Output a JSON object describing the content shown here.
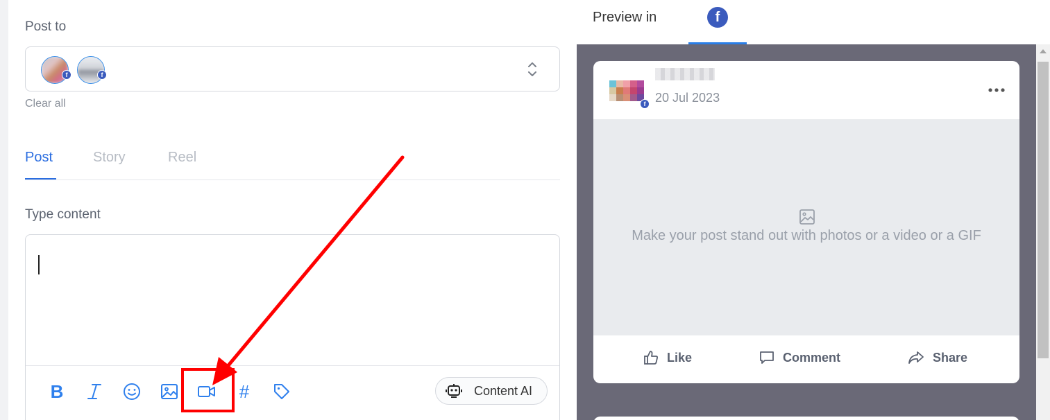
{
  "composer": {
    "post_to_label": "Post to",
    "clear_all": "Clear all",
    "tabs": [
      {
        "label": "Post",
        "active": true
      },
      {
        "label": "Story",
        "active": false
      },
      {
        "label": "Reel",
        "active": false
      }
    ],
    "type_content_label": "Type content",
    "toolbar": {
      "icons": [
        "bold-icon",
        "italic-icon",
        "emoji-icon",
        "image-icon",
        "video-icon",
        "hashtag-icon",
        "tag-icon"
      ],
      "bold_glyph": "B",
      "hashtag_glyph": "#",
      "content_ai_label": "Content AI"
    },
    "accounts": [
      {
        "network": "facebook",
        "badge": "f"
      },
      {
        "network": "facebook",
        "badge": "f"
      }
    ]
  },
  "preview": {
    "header_label": "Preview in",
    "network_tab_glyph": "f",
    "card": {
      "date": "20 Jul 2023",
      "badge": "f",
      "media_placeholder": "Make your post stand out with photos or a video or a GIF",
      "actions": {
        "like": "Like",
        "comment": "Comment",
        "share": "Share"
      }
    }
  },
  "colors": {
    "accent": "#2a6de0",
    "facebook": "#3b5bbd",
    "preview_bg": "#6a6977",
    "annotation": "#ff0000"
  }
}
